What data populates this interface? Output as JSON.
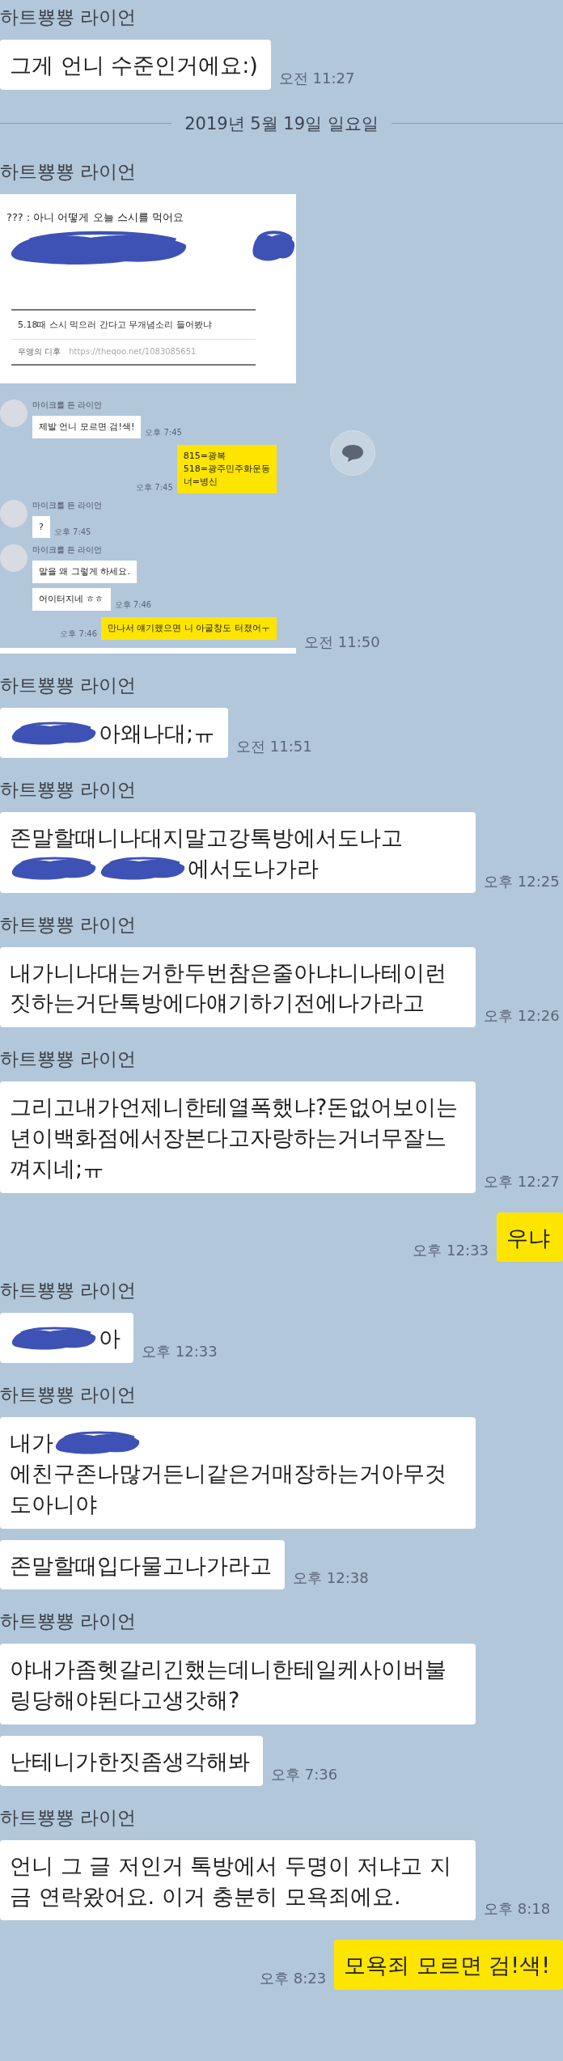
{
  "messages": [
    {
      "kind": "incoming",
      "sender": "하트뿅뿅 라이언",
      "bubbles": [
        {
          "parts": [
            {
              "kind": "text",
              "text": "그게 언니 수준인거에요:)"
            }
          ]
        }
      ],
      "time": "오전 11:27"
    },
    {
      "kind": "date",
      "text": "2019년 5월 19일 일요일"
    },
    {
      "kind": "screenshot",
      "sender": "하트뿅뿅 라이언",
      "post_title": "??? : 아니 어떻게 오늘 스시를 먹어요",
      "link_title": "5.18때 스시 먹으러 간다고 무개념소리 들어봤냐",
      "link_source": "우앵의 디후",
      "link_url": "https://theqoo.net/1083085651",
      "chat": [
        {
          "kind": "incoming",
          "sender": "마이크를 든 라이언",
          "bubbles": [
            "제발 언니 모르면 검!색!"
          ],
          "time": "오후 7:45"
        },
        {
          "kind": "outgoing",
          "bubbles": [
            "815=광복\n518=광주민주화운동\n너=병신"
          ],
          "time": "오후 7:45"
        },
        {
          "kind": "incoming",
          "sender": "마이크를 든 라이언",
          "bubbles": [
            "?"
          ],
          "time": "오후 7:45"
        },
        {
          "kind": "incoming",
          "sender": "마이크를 든 라이언",
          "bubbles": [
            "말을 왜 그렇게 하세요.",
            "어이터지네 ㅎㅎ"
          ],
          "time": "오후 7:46"
        },
        {
          "kind": "outgoing",
          "bubbles": [
            "만나서 얘기했으면 니 아굴창도 터졌어ㅜ"
          ],
          "time": "오후 7:46"
        }
      ],
      "time": "오전 11:50"
    },
    {
      "kind": "incoming",
      "sender": "하트뿅뿅 라이언",
      "bubbles": [
        {
          "parts": [
            {
              "kind": "redaction"
            },
            {
              "kind": "text",
              "text": "아왜나대;ㅠ"
            }
          ]
        }
      ],
      "time": "오전 11:51"
    },
    {
      "kind": "incoming",
      "sender": "하트뿅뿅 라이언",
      "bubbles": [
        {
          "parts": [
            {
              "kind": "text",
              "text": "존말할때니나대지말고강톡방에서도나고"
            },
            {
              "kind": "redaction"
            },
            {
              "kind": "redaction"
            },
            {
              "kind": "text",
              "text": "에서도나가라"
            }
          ]
        }
      ],
      "time": "오후 12:25"
    },
    {
      "kind": "incoming",
      "sender": "하트뿅뿅 라이언",
      "bubbles": [
        {
          "parts": [
            {
              "kind": "text",
              "text": "내가니나대는거한두번참은줄아냐니나테이런짓하는거단톡방에다얘기하기전에나가라고"
            }
          ]
        }
      ],
      "time": "오후 12:26"
    },
    {
      "kind": "incoming",
      "sender": "하트뿅뿅 라이언",
      "bubbles": [
        {
          "parts": [
            {
              "kind": "text",
              "text": "그리고내가언제니한테열폭했냐?돈없어보이는년이백화점에서장본다고자랑하는거너무잘느껴지네;ㅠ"
            }
          ]
        }
      ],
      "time": "오후 12:27"
    },
    {
      "kind": "outgoing",
      "bubbles": [
        {
          "parts": [
            {
              "kind": "text",
              "text": "우냐"
            }
          ]
        }
      ],
      "time": "오후 12:33"
    },
    {
      "kind": "incoming",
      "sender": "하트뿅뿅 라이언",
      "bubbles": [
        {
          "parts": [
            {
              "kind": "redaction"
            },
            {
              "kind": "text",
              "text": "아"
            }
          ]
        }
      ],
      "time": "오후 12:33"
    },
    {
      "kind": "incoming",
      "sender": "하트뿅뿅 라이언",
      "bubbles": [
        {
          "parts": [
            {
              "kind": "text",
              "text": "내가"
            },
            {
              "kind": "redaction"
            },
            {
              "kind": "text",
              "text": "에친구존나많거든니같은거매장하는거아무것도아니야"
            }
          ]
        },
        {
          "parts": [
            {
              "kind": "text",
              "text": "존말할때입다물고나가라고"
            }
          ]
        }
      ],
      "time": "오후 12:38"
    },
    {
      "kind": "incoming",
      "sender": "하트뿅뿅 라이언",
      "bubbles": [
        {
          "parts": [
            {
              "kind": "text",
              "text": "야내가좀헷갈리긴했는데니한테일케사이버불링당해야된다고생갓해?"
            }
          ]
        },
        {
          "parts": [
            {
              "kind": "text",
              "text": "난테니가한짓좀생각해봐"
            }
          ]
        }
      ],
      "time": "오후 7:36"
    },
    {
      "kind": "incoming",
      "sender": "하트뿅뿅 라이언",
      "bubbles": [
        {
          "parts": [
            {
              "kind": "text",
              "text": "언니 그 글 저인거 톡방에서 두명이 저냐고 지금 연락왔어요. 이거 충분히 모욕죄에요."
            }
          ]
        }
      ],
      "time": "오후 8:18"
    },
    {
      "kind": "outgoing",
      "bubbles": [
        {
          "parts": [
            {
              "kind": "text",
              "text": "모욕죄 모르면 검!색!"
            }
          ]
        }
      ],
      "time": "오후 8:23"
    }
  ]
}
